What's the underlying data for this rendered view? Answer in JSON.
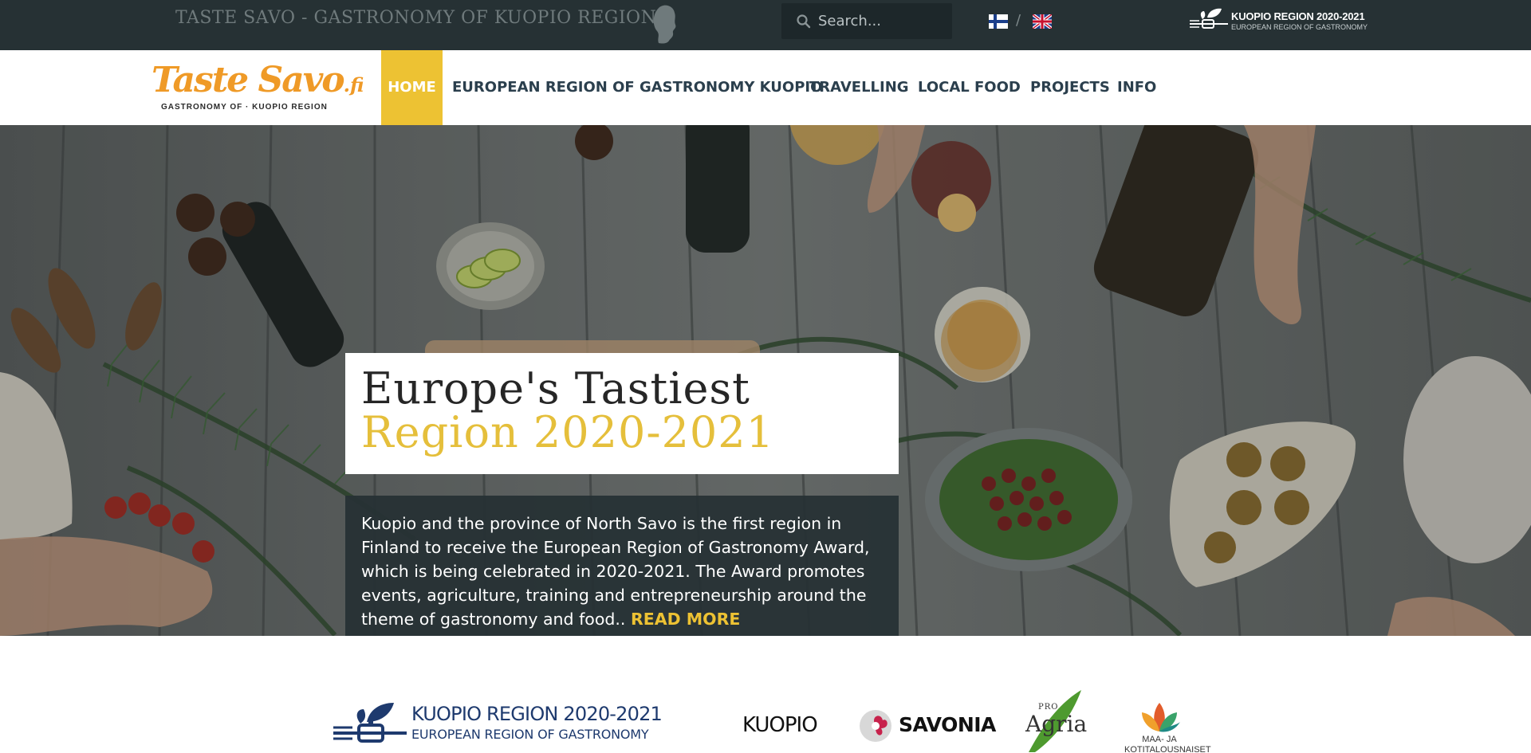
{
  "topbar": {
    "site_title": "TASTE SAVO - GASTRONOMY OF KUOPIO REGION",
    "search_placeholder": "Search...",
    "language_separator": "/",
    "languages": [
      "Finnish",
      "English"
    ],
    "badge_line1": "KUOPIO REGION 2020-2021",
    "badge_line2": "EUROPEAN REGION OF GASTRONOMY"
  },
  "logo": {
    "text_main": "Taste Savo",
    "text_fi": ".fi",
    "subtitle": "GASTRONOMY OF · KUOPIO REGION"
  },
  "nav": {
    "items": [
      {
        "label": "HOME",
        "active": true
      },
      {
        "label": "EUROPEAN REGION OF GASTRONOMY KUOPIO"
      },
      {
        "label": "TRAVELLING"
      },
      {
        "label": "LOCAL FOOD"
      },
      {
        "label": "PROJECTS"
      },
      {
        "label": "INFO"
      }
    ],
    "active_color": "#edc233"
  },
  "hero": {
    "headline_line1": "Europe's Tastiest",
    "headline_line2": "Region 2020-2021",
    "intro": "Kuopio and the province of North Savo is the first region in Finland to receive the European Region of Gastronomy Award, which is being celebrated in 2020-2021. The Award promotes events, agriculture, training and entrepreneurship around the theme of gastronomy and food.. ",
    "read_more": "READ MORE"
  },
  "partners": {
    "erg_line1": "KUOPIO REGION 2020-2021",
    "erg_line2": "EUROPEAN REGION OF GASTRONOMY",
    "kuopio": "KUOPIO",
    "savonia": "SAVONIA",
    "agria_pro": "PRO",
    "agria": "Agria",
    "maa_line1": "MAA- JA",
    "maa_line2": "KOTITALOUSNAISET"
  },
  "colors": {
    "topbar_bg": "#263134",
    "accent_yellow": "#edc233",
    "nav_text": "#2b3f4d",
    "logo_orange": "#ef9a27"
  }
}
